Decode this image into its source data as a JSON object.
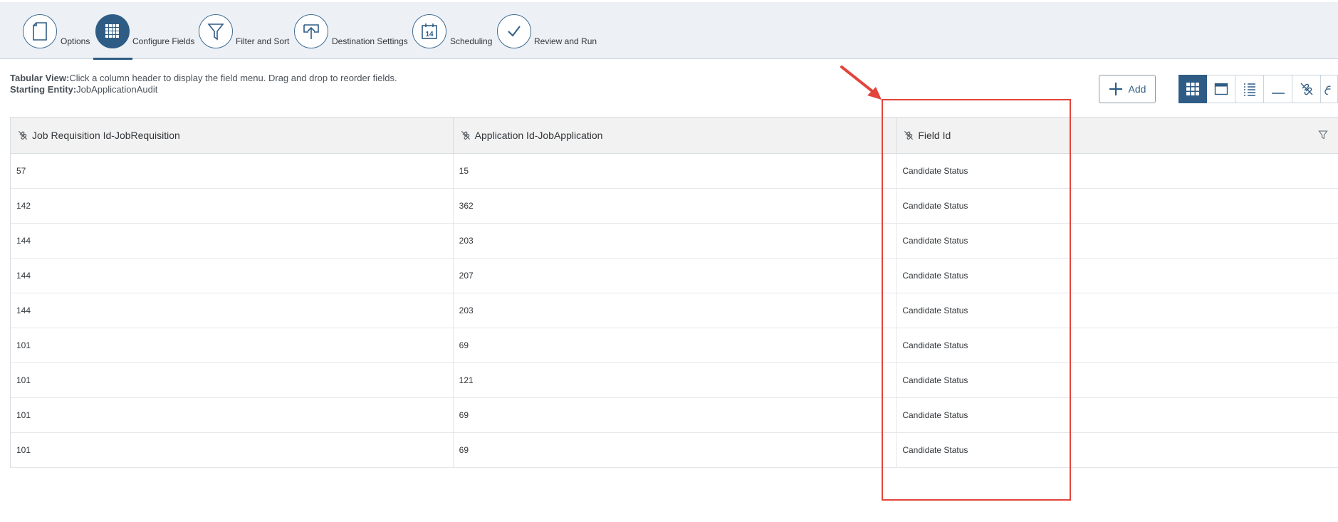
{
  "wizard": {
    "steps": [
      {
        "label": "Options",
        "icon": "document-icon",
        "active": false
      },
      {
        "label": "Configure Fields",
        "icon": "grid-icon",
        "active": true
      },
      {
        "label": "Filter and Sort",
        "icon": "funnel-icon",
        "active": false
      },
      {
        "label": "Destination Settings",
        "icon": "upload-icon",
        "active": false
      },
      {
        "label": "Scheduling",
        "icon": "calendar-icon",
        "active": false
      },
      {
        "label": "Review and Run",
        "icon": "check-icon",
        "active": false
      }
    ],
    "calendar_day": "14"
  },
  "info": {
    "view_label": "Tabular View:",
    "view_text": "Click a column header to display the field menu. Drag and drop to reorder fields.",
    "entity_label": "Starting Entity:",
    "entity_value": "JobApplicationAudit"
  },
  "toolbar": {
    "add_label": "Add",
    "views": [
      "grid-view-icon",
      "panel-view-icon",
      "list-view-icon",
      "minimize-icon",
      "unlink-icon",
      "link-icon"
    ]
  },
  "table": {
    "columns": [
      {
        "label": "Job Requisition Id-JobRequisition",
        "icon": "unlink-icon"
      },
      {
        "label": "Application Id-JobApplication",
        "icon": "unlink-icon"
      },
      {
        "label": "Field Id",
        "icon": "unlink-icon"
      }
    ],
    "rows": [
      [
        "57",
        "15",
        "Candidate Status"
      ],
      [
        "142",
        "362",
        "Candidate Status"
      ],
      [
        "144",
        "203",
        "Candidate Status"
      ],
      [
        "144",
        "207",
        "Candidate Status"
      ],
      [
        "144",
        "203",
        "Candidate Status"
      ],
      [
        "101",
        "69",
        "Candidate Status"
      ],
      [
        "101",
        "121",
        "Candidate Status"
      ],
      [
        "101",
        "69",
        "Candidate Status"
      ],
      [
        "101",
        "69",
        "Candidate Status"
      ]
    ]
  },
  "colors": {
    "accent": "#2f5c85",
    "annotation": "#e2453c"
  }
}
